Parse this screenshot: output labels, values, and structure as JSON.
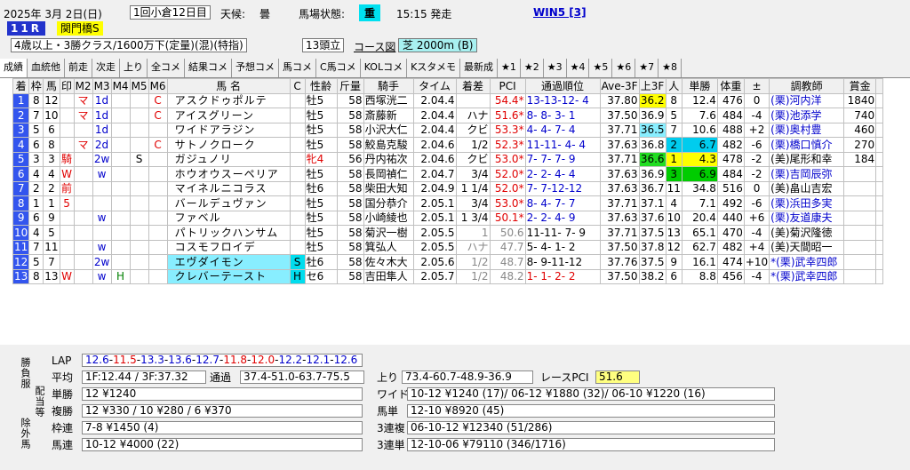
{
  "header": {
    "date": "2025年 3月 2日(日)",
    "meeting": "1回小倉12日目",
    "weather_label": "天候:",
    "weather": "曇",
    "track_label": "馬場状態:",
    "track": "重",
    "start": "15:15 発走",
    "win5": "WIN5 [3]",
    "race_no": "11R",
    "race_name": "関門橋S",
    "conditions": "4歳以上・3勝クラス/1600万下(定量)(混)(特指)",
    "runners": "13頭立",
    "course_btn": "コース図",
    "course": "芝 2000m (B)"
  },
  "tabs": [
    "成績",
    "血統他",
    "前走",
    "次走",
    "上り",
    "全コメ",
    "結果コメ",
    "予想コメ",
    "馬コメ",
    "C馬コメ",
    "KOLコメ",
    "Kスタメモ",
    "最新成",
    "★1",
    "★2",
    "★3",
    "★4",
    "★5",
    "★6",
    "★7",
    "★8"
  ],
  "columns": [
    "着",
    "枠",
    "馬",
    "印",
    "M2",
    "M3",
    "M4",
    "M5",
    "M6",
    "馬 名",
    "C",
    "性齢",
    "斤量",
    "騎手",
    "タイム",
    "着差",
    "PCI",
    "通過順位",
    "Ave-3F",
    "上3F",
    "人",
    "単勝",
    "体重",
    "±",
    "調教師",
    "賞金",
    ""
  ],
  "colors": {
    "frame1": "#ffffff",
    "frame2": "#000000",
    "frame3": "#e00000",
    "frame4": "#0040e0",
    "frame5": "#ffff00",
    "frame6": "#00a000",
    "frame7": "#ff8000",
    "frame8": "#ff70c0",
    "rank1": "#3355ee",
    "top3f": "#ffff00",
    "top3f_2": "#22dd22",
    "nin_green": "#00cc00",
    "nin_yellow": "#ffff00",
    "nin_cyan": "#00ccee",
    "name_cyan": "#88eeff",
    "red_mark": "#e00000"
  },
  "rows": [
    {
      "chaku": "1",
      "waku": "8",
      "uma": "12",
      "in": "",
      "m2": "マ",
      "m3": "1d",
      "m4": "",
      "m5": "",
      "m6": "C",
      "name": "アスクドゥポルテ",
      "c": "",
      "sexage": "牡5",
      "kin": "58",
      "jockey": "西塚洸二",
      "time": "2.04.4",
      "diff": "",
      "pci": "54.4*",
      "pass": "13-13-12- 4",
      "ave": "37.80",
      "up3f": "36.2",
      "nin": "8",
      "odds": "12.4",
      "wt": "476",
      "pm": "0",
      "trainer": "(栗)河内洋",
      "prize": "1840"
    },
    {
      "chaku": "2",
      "waku": "7",
      "uma": "10",
      "in": "",
      "m2": "マ",
      "m3": "1d",
      "m4": "",
      "m5": "",
      "m6": "C",
      "name": "アイスグリーン",
      "c": "",
      "sexage": "牡5",
      "kin": "58",
      "jockey": "斎藤新",
      "time": "2.04.4",
      "diff": "ハナ",
      "pci": "51.6*",
      "pass": "8- 8- 3- 1",
      "ave": "37.50",
      "up3f": "36.9",
      "nin": "5",
      "odds": "7.6",
      "wt": "484",
      "pm": "-4",
      "trainer": "(栗)池添学",
      "prize": "740"
    },
    {
      "chaku": "3",
      "waku": "5",
      "uma": "6",
      "in": "",
      "m2": "",
      "m3": "1d",
      "m4": "",
      "m5": "",
      "m6": "",
      "name": "ワイドアラジン",
      "c": "",
      "sexage": "牡5",
      "kin": "58",
      "jockey": "小沢大仁",
      "time": "2.04.4",
      "diff": "クビ",
      "pci": "53.3*",
      "pass": "4- 4- 7- 4",
      "ave": "37.71",
      "up3f": "36.5",
      "nin": "7",
      "odds": "10.6",
      "wt": "488",
      "pm": "+2",
      "trainer": "(栗)奥村豊",
      "prize": "460"
    },
    {
      "chaku": "4",
      "waku": "6",
      "uma": "8",
      "in": "",
      "m2": "マ",
      "m3": "2d",
      "m4": "",
      "m5": "",
      "m6": "C",
      "name": "サトノクローク",
      "c": "",
      "sexage": "牡5",
      "kin": "58",
      "jockey": "鮫島克駿",
      "time": "2.04.6",
      "diff": "1/2",
      "pci": "52.3*",
      "pass": "11-11- 4- 4",
      "ave": "37.63",
      "up3f": "36.8",
      "nin": "2",
      "odds": "6.7",
      "wt": "482",
      "pm": "-6",
      "trainer": "(栗)橋口慎介",
      "prize": "270"
    },
    {
      "chaku": "5",
      "waku": "3",
      "uma": "3",
      "in": "騎",
      "m2": "",
      "m3": "2w",
      "m4": "",
      "m5": "S",
      "m6": "",
      "name": "ガジュノリ",
      "c": "",
      "sexage": "牝4",
      "kin": "56",
      "jockey": "丹内祐次",
      "time": "2.04.6",
      "diff": "クビ",
      "pci": "53.0*",
      "pass": "7- 7- 7- 9",
      "ave": "37.71",
      "up3f": "36.6",
      "nin": "1",
      "odds": "4.3",
      "wt": "478",
      "pm": "-2",
      "trainer": "(美)尾形和幸",
      "prize": "184"
    },
    {
      "chaku": "6",
      "waku": "4",
      "uma": "4",
      "in": "W",
      "m2": "",
      "m3": "w",
      "m4": "",
      "m5": "",
      "m6": "",
      "name": "ホウオウスーペリア",
      "c": "",
      "sexage": "牡5",
      "kin": "58",
      "jockey": "長岡禎仁",
      "time": "2.04.7",
      "diff": "3/4",
      "pci": "52.0*",
      "pass": "2- 2- 4- 4",
      "ave": "37.63",
      "up3f": "36.9",
      "nin": "3",
      "odds": "6.9",
      "wt": "484",
      "pm": "-2",
      "trainer": "(栗)吉岡辰弥",
      "prize": ""
    },
    {
      "chaku": "7",
      "waku": "2",
      "uma": "2",
      "in": "前",
      "m2": "",
      "m3": "",
      "m4": "",
      "m5": "",
      "m6": "",
      "name": "マイネルニコラス",
      "c": "",
      "sexage": "牡6",
      "kin": "58",
      "jockey": "柴田大知",
      "time": "2.04.9",
      "diff": "1 1/4",
      "pci": "52.0*",
      "pass": "7- 7-12-12",
      "ave": "37.63",
      "up3f": "36.7",
      "nin": "11",
      "odds": "34.8",
      "wt": "516",
      "pm": "0",
      "trainer": "(美)畠山吉宏",
      "prize": ""
    },
    {
      "chaku": "8",
      "waku": "1",
      "uma": "1",
      "in": "5",
      "m2": "",
      "m3": "",
      "m4": "",
      "m5": "",
      "m6": "",
      "name": "バールデュヴァン",
      "c": "",
      "sexage": "牡5",
      "kin": "58",
      "jockey": "国分恭介",
      "time": "2.05.1",
      "diff": "3/4",
      "pci": "53.0*",
      "pass": "8- 4- 7- 7",
      "ave": "37.71",
      "up3f": "37.1",
      "nin": "4",
      "odds": "7.1",
      "wt": "492",
      "pm": "-6",
      "trainer": "(栗)浜田多実",
      "prize": ""
    },
    {
      "chaku": "9",
      "waku": "6",
      "uma": "9",
      "in": "",
      "m2": "",
      "m3": "w",
      "m4": "",
      "m5": "",
      "m6": "",
      "name": "ファベル",
      "c": "",
      "sexage": "牡5",
      "kin": "58",
      "jockey": "小崎綾也",
      "time": "2.05.1",
      "diff": "1 3/4",
      "pci": "50.1*",
      "pass": "2- 2- 4- 9",
      "ave": "37.63",
      "up3f": "37.6",
      "nin": "10",
      "odds": "20.4",
      "wt": "440",
      "pm": "+6",
      "trainer": "(栗)友道康夫",
      "prize": ""
    },
    {
      "chaku": "10",
      "waku": "4",
      "uma": "5",
      "in": "",
      "m2": "",
      "m3": "",
      "m4": "",
      "m5": "",
      "m6": "",
      "name": "パトリックハンサム",
      "c": "",
      "sexage": "牡5",
      "kin": "58",
      "jockey": "菊沢一樹",
      "time": "2.05.5",
      "diff": "1",
      "pci": "50.6",
      "pass": "11-11- 7- 9",
      "ave": "37.71",
      "up3f": "37.5",
      "nin": "13",
      "odds": "65.1",
      "wt": "470",
      "pm": "-4",
      "trainer": "(美)菊沢隆徳",
      "prize": ""
    },
    {
      "chaku": "11",
      "waku": "7",
      "uma": "11",
      "in": "",
      "m2": "",
      "m3": "w",
      "m4": "",
      "m5": "",
      "m6": "",
      "name": "コスモフロイデ",
      "c": "",
      "sexage": "牡5",
      "kin": "58",
      "jockey": "箕弘人",
      "time": "2.05.5",
      "diff": "ハナ",
      "pci": "47.7",
      "pass": "5- 4- 1- 2",
      "ave": "37.50",
      "up3f": "37.8",
      "nin": "12",
      "odds": "62.7",
      "wt": "482",
      "pm": "+4",
      "trainer": "(美)天間昭一",
      "prize": ""
    },
    {
      "chaku": "12",
      "waku": "5",
      "uma": "7",
      "in": "",
      "m2": "",
      "m3": "2w",
      "m4": "",
      "m5": "",
      "m6": "",
      "name": "エヴダイモン",
      "c": "S",
      "sexage": "牡6",
      "kin": "58",
      "jockey": "佐々木大",
      "time": "2.05.6",
      "diff": "1/2",
      "pci": "48.7",
      "pass": "8- 9-11-12",
      "ave": "37.76",
      "up3f": "37.5",
      "nin": "9",
      "odds": "16.1",
      "wt": "474",
      "pm": "+10",
      "trainer": "*(栗)武幸四郎",
      "prize": ""
    },
    {
      "chaku": "13",
      "waku": "8",
      "uma": "13",
      "in": "W",
      "m2": "",
      "m3": "w",
      "m4": "H",
      "m5": "",
      "m6": "",
      "name": "クレバーテースト",
      "c": "H",
      "sexage": "セ6",
      "kin": "58",
      "jockey": "吉田隼人",
      "time": "2.05.7",
      "diff": "1/2",
      "pci": "48.2",
      "pass": "1- 1- 2- 2",
      "ave": "37.50",
      "up3f": "38.2",
      "nin": "6",
      "odds": "8.8",
      "wt": "456",
      "pm": "-4",
      "trainer": "*(栗)武幸四郎",
      "prize": ""
    }
  ],
  "bottom": {
    "side1": "勝負服",
    "side2": "配当等",
    "side3": "除外馬",
    "lap_label": "LAP",
    "lap": [
      "12.6",
      "11.5",
      "13.3",
      "13.6",
      "12.7",
      "11.8",
      "12.0",
      "12.2",
      "12.1",
      "12.6"
    ],
    "avg_label": "平均",
    "avg": "1F:12.44 / 3F:37.32",
    "pass_label": "通過",
    "pass": "37.4-51.0-63.7-75.5",
    "agari_label": "上り",
    "agari": "73.4-60.7-48.9-36.9",
    "pci_label": "レースPCI",
    "pci": "51.6",
    "tansho_label": "単勝",
    "tansho": "12 ¥1240",
    "fukusho_label": "複勝",
    "fukusho": "12 ¥330 / 10 ¥280 / 6 ¥370",
    "wakuren_label": "枠連",
    "wakuren": "7-8 ¥1450 (4)",
    "umaren_label": "馬連",
    "umaren": "10-12 ¥4000 (22)",
    "wide_label": "ワイド",
    "wide": "10-12 ¥1240 (17)/ 06-12 ¥1880 (32)/ 06-10 ¥1220 (16)",
    "umatan_label": "馬単",
    "umatan": "12-10 ¥8920 (45)",
    "sanrenpuku_label": "3連複",
    "sanrenpuku": "06-10-12 ¥12340 (51/286)",
    "sanrentan_label": "3連単",
    "sanrentan": "12-10-06 ¥79110 (346/1716)"
  }
}
